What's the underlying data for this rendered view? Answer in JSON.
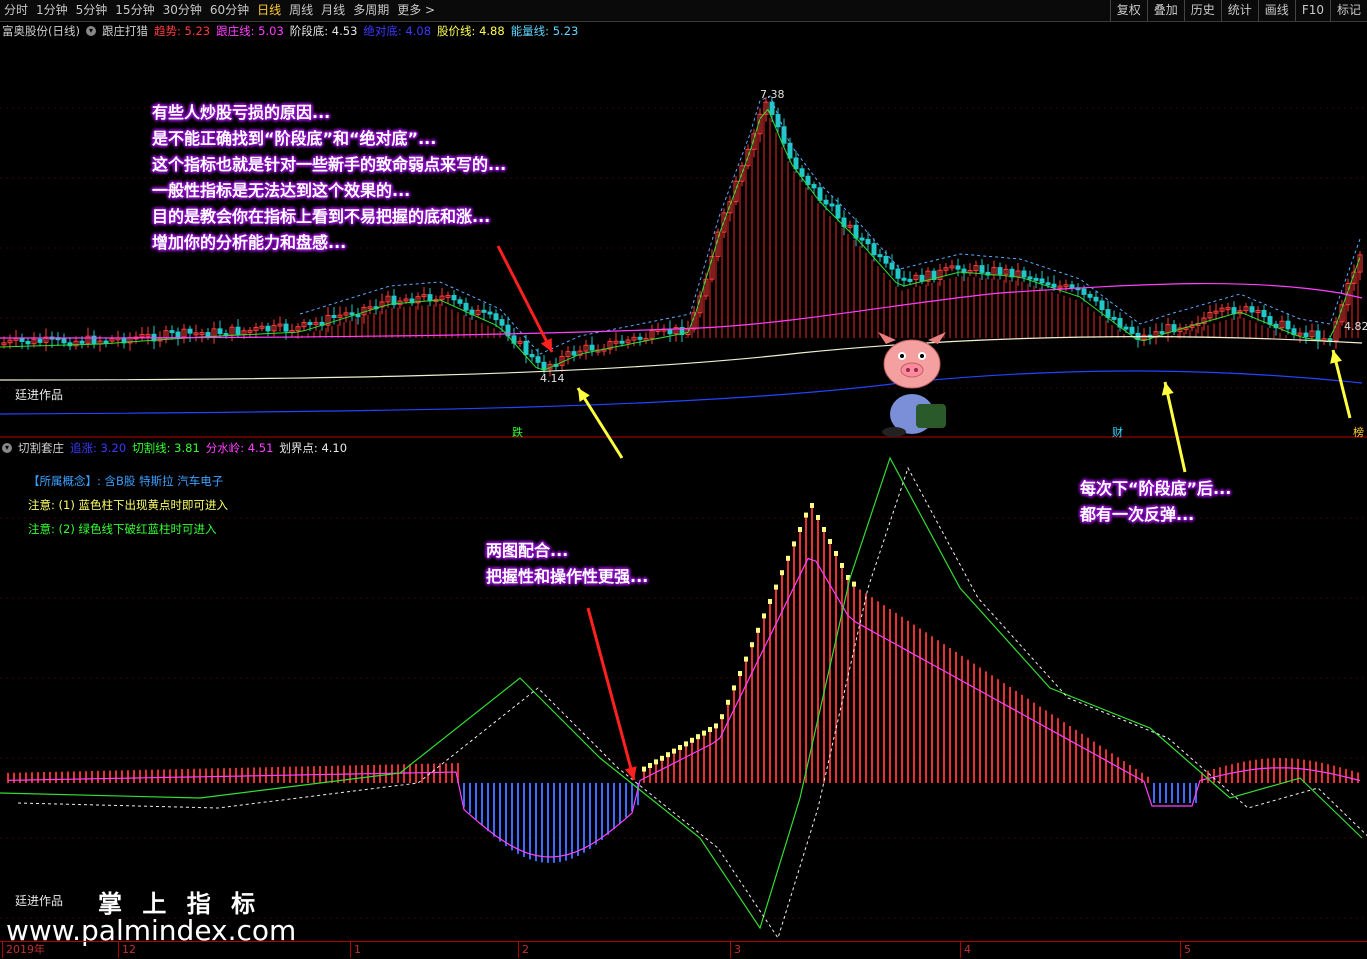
{
  "toolbar": {
    "periods": [
      "分时",
      "1分钟",
      "5分钟",
      "15分钟",
      "30分钟",
      "60分钟",
      "日线",
      "周线",
      "月线",
      "多周期",
      "更多 >"
    ],
    "active_period": "日线",
    "right_buttons": [
      "复权",
      "叠加",
      "历史",
      "统计",
      "画线",
      "F10",
      "标记"
    ]
  },
  "top_panel": {
    "stock_name": "富奥股份(日线)",
    "indicator_name": "跟庄打猎",
    "values": [
      {
        "label": "趋势:",
        "value": "5.23",
        "color": "#ff3b3b"
      },
      {
        "label": "跟庄线:",
        "value": "5.03",
        "color": "#ff40ff"
      },
      {
        "label": "阶段底:",
        "value": "4.53",
        "color": "#e8e8e8"
      },
      {
        "label": "绝对底:",
        "value": "4.08",
        "color": "#3a3aff"
      },
      {
        "label": "股价线:",
        "value": "4.88",
        "color": "#ffff55"
      },
      {
        "label": "能量线:",
        "value": "5.23",
        "color": "#5fd7ff"
      }
    ],
    "watermark": "廷进作品",
    "marker_labels": [
      "跌",
      "财",
      "榜"
    ],
    "price_labels": [
      "7.38",
      "4.14",
      "4.82"
    ]
  },
  "bottom_panel": {
    "indicator_name": "切割套庄",
    "values": [
      {
        "label": "追涨:",
        "value": "3.20",
        "color": "#3a3aff"
      },
      {
        "label": "切割线:",
        "value": "3.81",
        "color": "#33ff33"
      },
      {
        "label": "分水岭:",
        "value": "4.51",
        "color": "#ff40ff"
      },
      {
        "label": "划界点:",
        "value": "4.10",
        "color": "#e8e8e8"
      }
    ],
    "concept_label": "【所属概念】: 含B股 特斯拉 汽车电子",
    "note1": "注意: (1) 蓝色柱下出现黄点时即可进入",
    "note2": "注意: (2) 绿色线下破红蓝柱时可进入",
    "watermark": "廷进作品"
  },
  "annotations": {
    "top_lines": [
      "有些人炒股亏损的原因...",
      "是不能正确找到“阶段底”和“绝对底”...",
      "这个指标也就是针对一些新手的致命弱点来写的...",
      "一般性指标是无法达到这个效果的...",
      "目的是教会你在指标上看到不易把握的底和涨...",
      "增加你的分析能力和盘感..."
    ],
    "right_lines": [
      "每次下“阶段底”后...",
      "都有一次反弹..."
    ],
    "middle_lines": [
      "两图配合...",
      "把握性和操作性更强..."
    ]
  },
  "branding": {
    "title": "掌 上 指 标",
    "url": "www.palmindex.com"
  },
  "time_axis": [
    "2019年",
    "12",
    "1",
    "2",
    "3",
    "4",
    "5"
  ],
  "colors": {
    "up": "#ff3b3b",
    "down": "#21c8c8",
    "magenta": "#ff40ff",
    "green": "#33dd33",
    "yellow": "#ffff55",
    "blue": "#2244ff",
    "annotation_glow": "#8a10c0"
  },
  "icons": [
    "pig-mascot-icon",
    "arrow-icon",
    "circle-icon"
  ]
}
